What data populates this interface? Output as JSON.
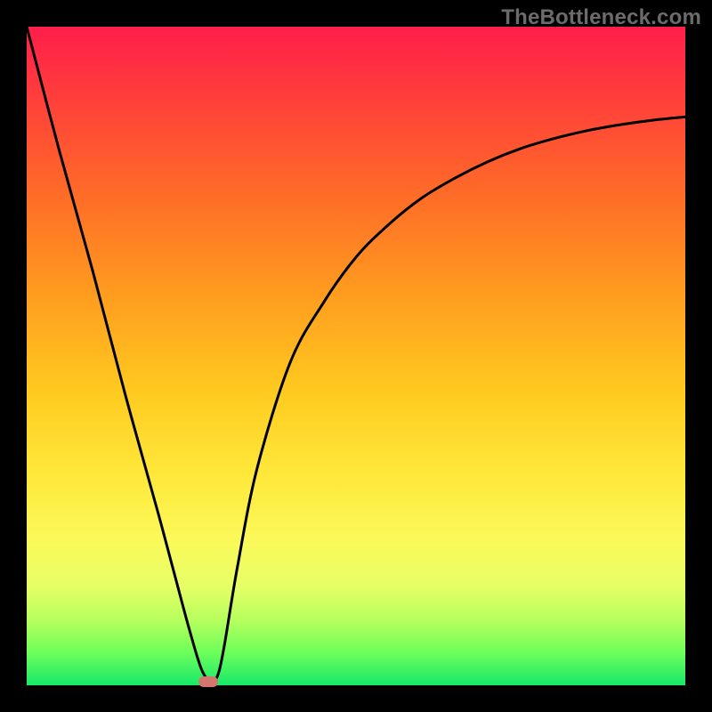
{
  "watermark": "TheBottleneck.com",
  "chart_data": {
    "type": "line",
    "title": "",
    "xlabel": "",
    "ylabel": "",
    "xlim": [
      0,
      100
    ],
    "ylim": [
      0,
      100
    ],
    "gradient_stops": [
      {
        "pos": 0,
        "color": "#ff1e4a"
      },
      {
        "pos": 10,
        "color": "#ff3c3c"
      },
      {
        "pos": 25,
        "color": "#ff6a28"
      },
      {
        "pos": 40,
        "color": "#ff9a1f"
      },
      {
        "pos": 55,
        "color": "#ffc91f"
      },
      {
        "pos": 68,
        "color": "#ffe83a"
      },
      {
        "pos": 78,
        "color": "#fbf95a"
      },
      {
        "pos": 85,
        "color": "#e6ff66"
      },
      {
        "pos": 90,
        "color": "#b7ff5e"
      },
      {
        "pos": 95,
        "color": "#6eff5a"
      },
      {
        "pos": 100,
        "color": "#17e86a"
      }
    ],
    "series": [
      {
        "name": "bottleneck-curve",
        "x": [
          0,
          5,
          10,
          15,
          20,
          24,
          26,
          27,
          28,
          29,
          30,
          32,
          35,
          40,
          45,
          50,
          55,
          60,
          65,
          70,
          75,
          80,
          85,
          90,
          95,
          100
        ],
        "y": [
          100,
          81,
          63,
          44,
          26,
          11,
          4,
          1.5,
          0.5,
          1.5,
          6,
          18,
          33,
          49,
          58,
          65,
          70,
          74,
          77,
          79.5,
          81.5,
          83,
          84.2,
          85.1,
          85.8,
          86.3
        ]
      }
    ],
    "marker": {
      "x": 27.5,
      "y": 0.6,
      "color": "#d4766e"
    }
  }
}
